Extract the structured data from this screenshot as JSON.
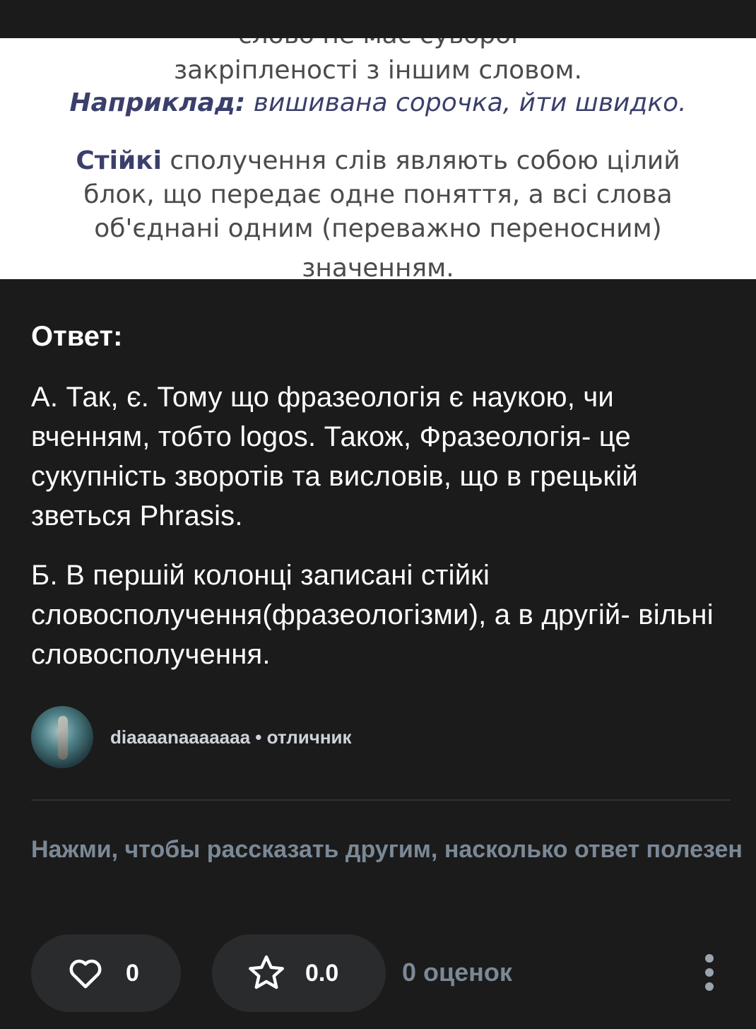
{
  "attached_image": {
    "cut_line": "слово не має суворої",
    "line1": "закріпленості з іншим словом.",
    "example_label": "Наприклад:",
    "example_text": " вишивана сорочка, йти швидко.",
    "stable_label": "Стійкі",
    "stable_line1_rest": " сполучення слів являють собою цілий",
    "stable_line2": "блок, що передає одне поняття, а всі слова",
    "stable_line3": "об'єднані одним (переважно переносним)",
    "stable_line4": "значенням."
  },
  "answer": {
    "heading": "Ответ:",
    "paragraph_a": "А. Так, є.  Тому що фразеологія є наукою, чи вченням, тобто logos. Також, Фразеологія- це сукупність зворотів та висловів, що в грецькій зветься Phrasis.",
    "paragraph_b": "Б. В першій колонці записані стійкі словосполучення(фразеологізми), а в другій- вільні словосполучення."
  },
  "author": {
    "username": "diaaaanaaaaaaa",
    "separator": " • ",
    "rank": "отличник"
  },
  "feedback": {
    "prompt": "Нажми, чтобы рассказать другим, насколько ответ полезен",
    "likes": "0",
    "rating": "0.0",
    "ratings_count": "0 оценок"
  },
  "icons": {
    "like": "heart-outline-icon",
    "rate": "star-outline-icon",
    "more": "more-vertical-icon"
  }
}
